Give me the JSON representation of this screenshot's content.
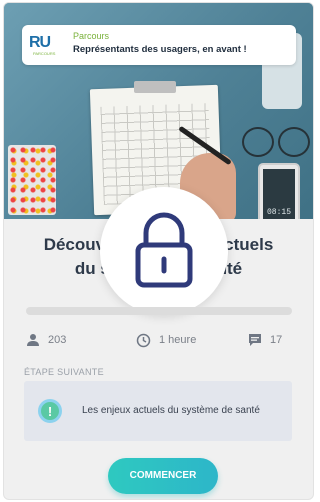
{
  "badge": {
    "label": "Parcours",
    "title": "Représentants des usagers, en avant !",
    "logo_text_main": "RU",
    "logo_text_accent": "R",
    "logo_sub": "PARCOURS"
  },
  "hero": {
    "phone_time": "08:15"
  },
  "course": {
    "title_line1": "Découvrir les enjeux actuels",
    "title_line2": "du système de santé",
    "locked": true,
    "progress_percent": 0
  },
  "stats": {
    "participants": "203",
    "duration": "1 heure",
    "comments": "17"
  },
  "next_step": {
    "section_label": "ÉTAPE SUIVANTE",
    "text": "Les enjeux actuels du système de santé"
  },
  "cta": {
    "label": "COMMENCER"
  },
  "colors": {
    "accent": "#2ec9c0",
    "title": "#2e3a4a",
    "lock": "#2f3a7a",
    "brand_green": "#7ab23b",
    "brand_blue": "#1e6fa8"
  }
}
